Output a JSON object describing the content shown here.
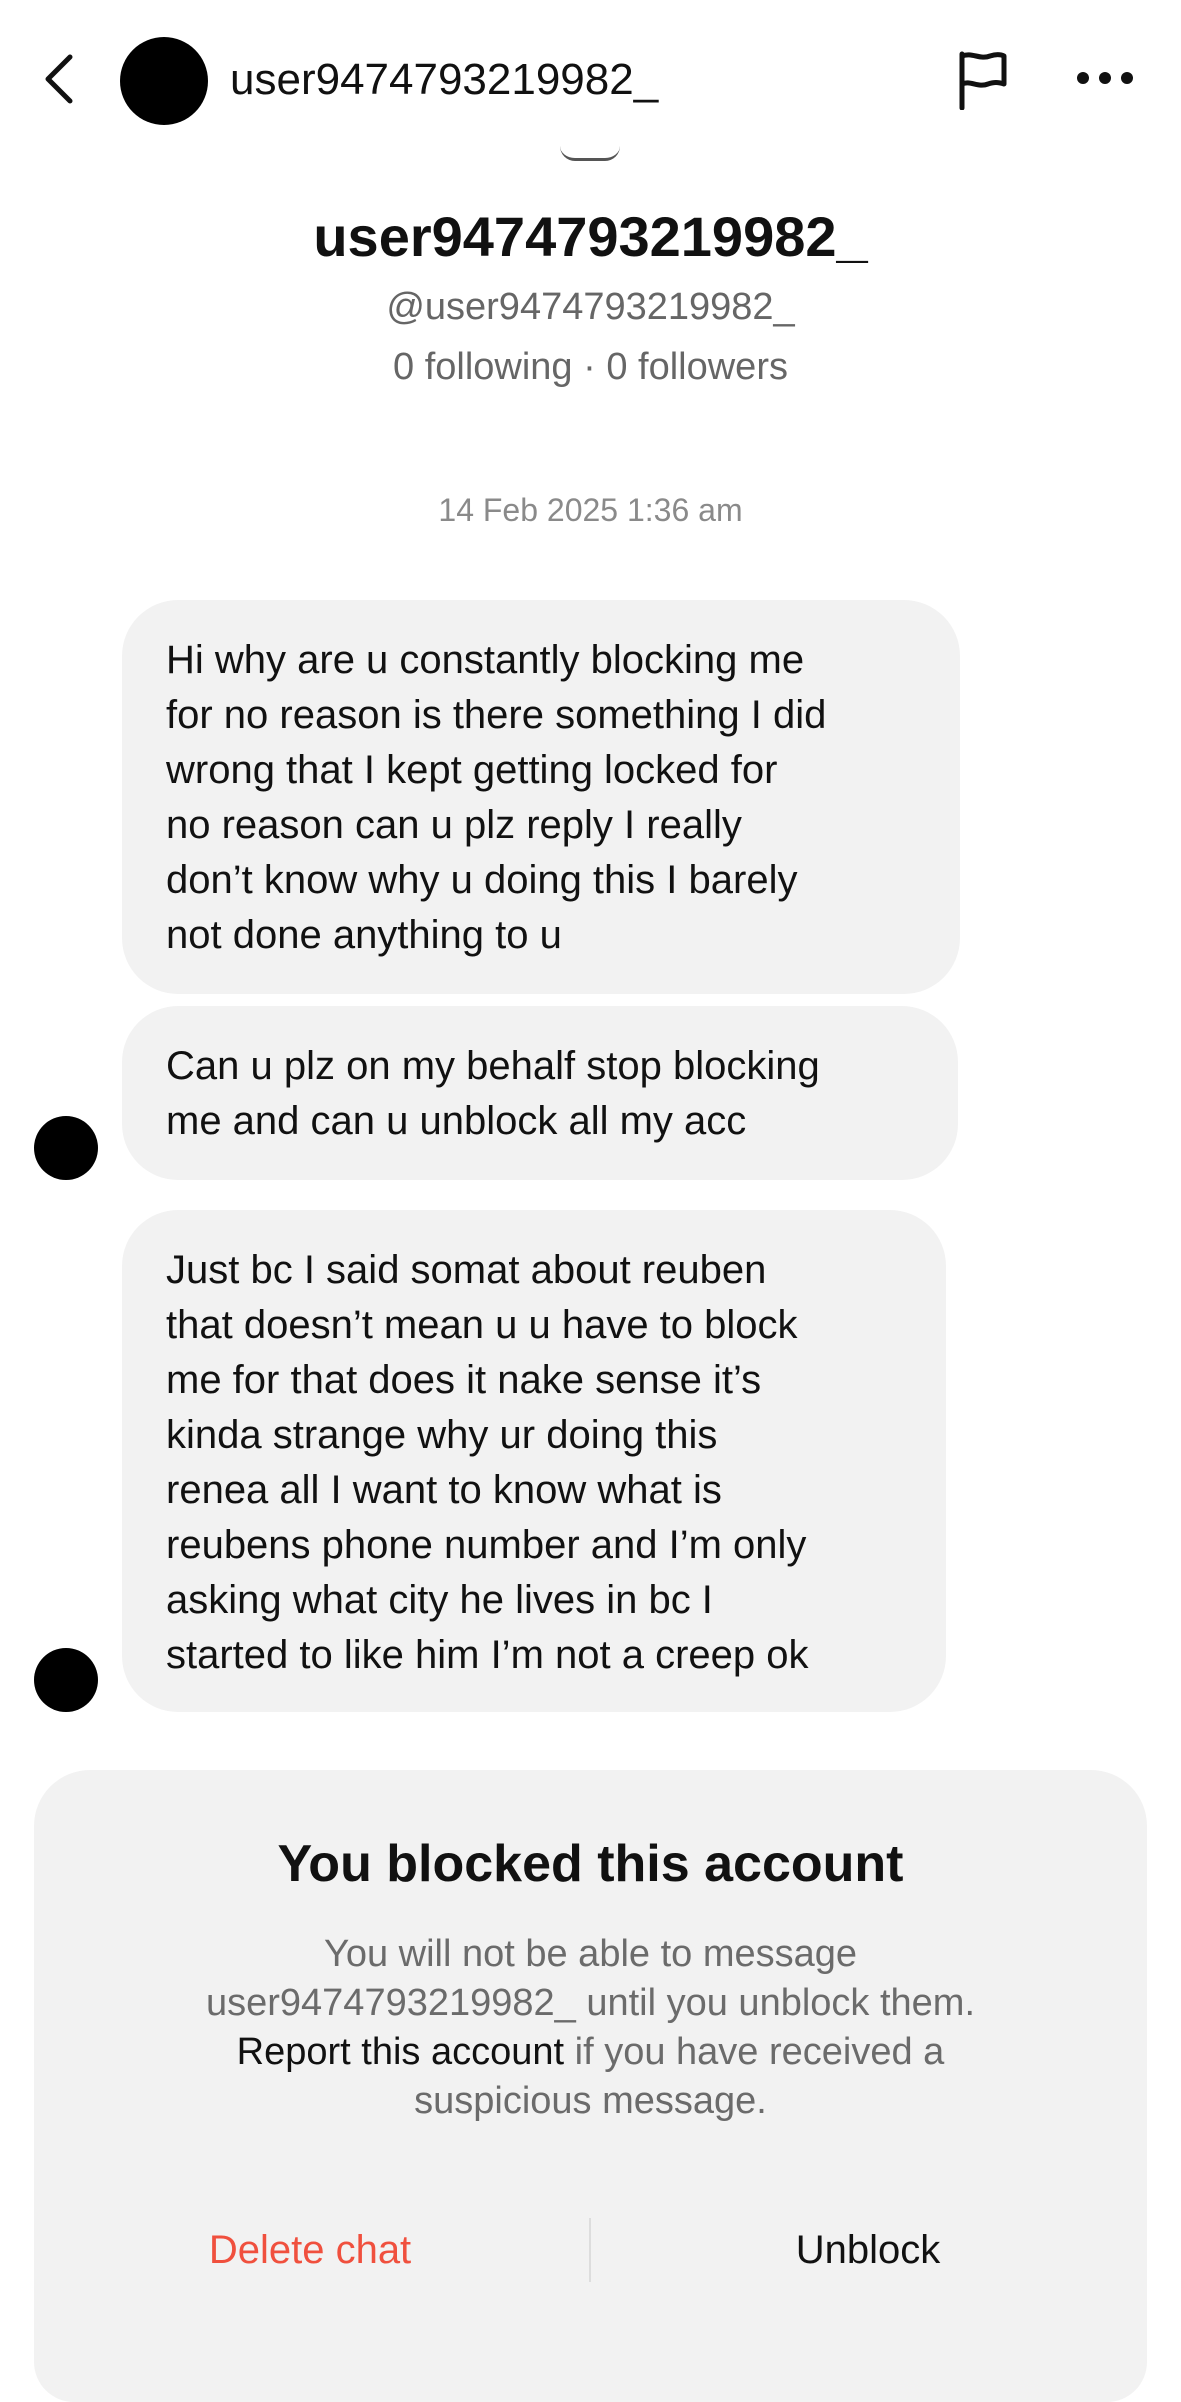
{
  "header": {
    "back_icon": "chevron-left-icon",
    "username": "user9474793219982_",
    "flag_icon": "flag-icon",
    "more_icon": "more-horizontal-icon"
  },
  "profile": {
    "display_name": "user9474793219982_",
    "handle": "@user9474793219982_",
    "stats": "0 following · 0 followers"
  },
  "conversation": {
    "timestamp": "14 Feb 2025 1:36 am",
    "messages": [
      {
        "lines": [
          "Hi why are u constantly blocking me",
          "for no reason is there something I did",
          "wrong that I kept getting locked for",
          "no reason can u plz reply I really",
          "don’t know why u doing this I barely",
          "not done anything to u"
        ]
      },
      {
        "lines": [
          "Can u plz on my behalf stop blocking",
          "me and can u unblock all my acc"
        ]
      },
      {
        "lines": [
          "Just bc I said somat about reuben",
          "that doesn’t mean u u have to block",
          "me for that does it nake sense it’s",
          "kinda strange why ur doing this",
          "renea all I want to know what is",
          "reubens phone number and I’m only",
          "asking what city he lives in bc I",
          "started to like him I’m not a creep ok"
        ]
      }
    ]
  },
  "blocked_panel": {
    "title": "You blocked this account",
    "line1": "You will not be able to message",
    "line2": "user9474793219982_ until you unblock them.",
    "report_link": "Report this account",
    "line3_rest": " if you have received a",
    "line4": "suspicious message.",
    "delete_label": "Delete chat",
    "unblock_label": "Unblock"
  },
  "colors": {
    "bubble_bg": "#f2f2f2",
    "delete_red": "#f0503e",
    "secondary_text": "#6b6b6b"
  }
}
